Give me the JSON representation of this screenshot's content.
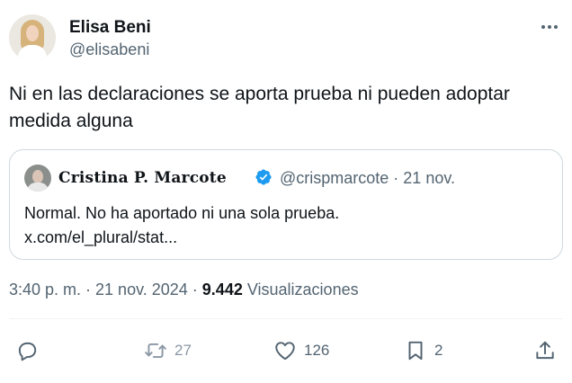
{
  "author": {
    "name": "Elisa Beni",
    "handle": "@elisabeni"
  },
  "tweet": {
    "text_line1": "Ni en las declaraciones se aporta prueba ni pueden adoptar",
    "text_line2": "medida alguna"
  },
  "quoted": {
    "name": "Cristina P. Marcote",
    "handle_date": "@crispmarcote · 21 nov.",
    "text_line1": "Normal. No ha aportado ni una sola prueba.",
    "text_line2": "x.com/el_plural/stat..."
  },
  "meta": {
    "time_date": "3:40 p. m. · 21 nov. 2024 · ",
    "views_count": "9.442",
    "views_label": " Visualizaciones"
  },
  "actions": {
    "retweets": "27",
    "likes": "126",
    "bookmarks": "2"
  },
  "colors": {
    "text": "#0f1419",
    "secondary": "#536471",
    "border": "#cfd9de",
    "verified": "#1d9bf0"
  }
}
